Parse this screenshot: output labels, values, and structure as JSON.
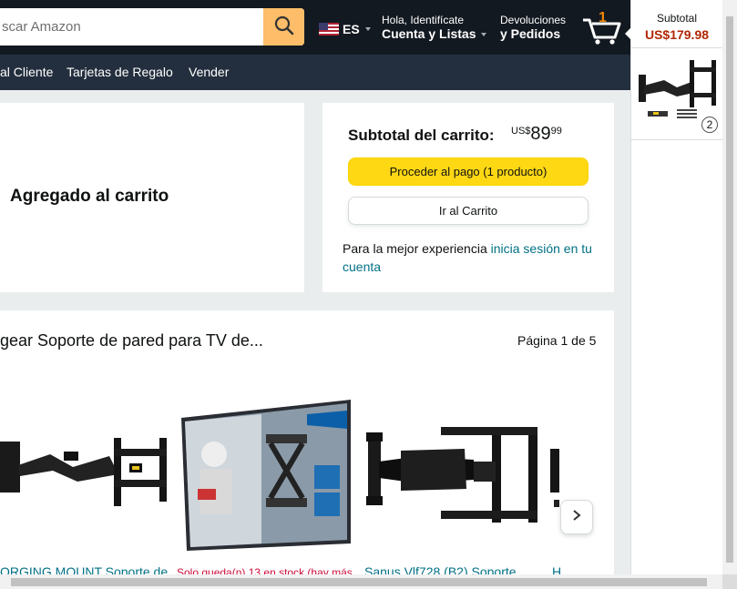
{
  "search": {
    "placeholder": "scar Amazon"
  },
  "header": {
    "language": "ES",
    "account_line1": "Hola, Identifícate",
    "account_line2": "Cuenta y Listas",
    "orders_line1": "Devoluciones",
    "orders_line2": "y Pedidos",
    "cart_count": "1"
  },
  "subnav": {
    "items": [
      "al Cliente",
      "Tarjetas de Regalo",
      "Vender"
    ]
  },
  "added": {
    "title": "Agregado al carrito"
  },
  "subtotal": {
    "label": "Subtotal del carrito:",
    "currency": "US$",
    "whole": "89",
    "fraction": "99",
    "checkout_button": "Proceder al pago (1 producto)",
    "cart_button": "Ir al Carrito",
    "signin_prefix": "Para la mejor experiencia ",
    "signin_link": "inicia sesión en tu cuenta"
  },
  "recommendations": {
    "title": "gear Soporte de pared para TV de...",
    "page": "Página 1 de 5",
    "products": [
      {
        "text": "ORGING MOUNT Soporte de",
        "kind": "link"
      },
      {
        "text": "Solo queda(n) 13 en stock (hay más",
        "kind": "warning"
      },
      {
        "text": "Sanus Vlf728 (B2) Soporte",
        "kind": "link"
      },
      {
        "text": "H",
        "kind": "link"
      }
    ]
  },
  "side_panel": {
    "subtotal_label": "Subtotal",
    "subtotal_price": "US$179.98",
    "quantity": "2"
  },
  "colors": {
    "nav": "#131921",
    "subnav": "#232f3e",
    "checkout": "#ffd814",
    "link": "#007185",
    "price_red": "#b12704"
  }
}
